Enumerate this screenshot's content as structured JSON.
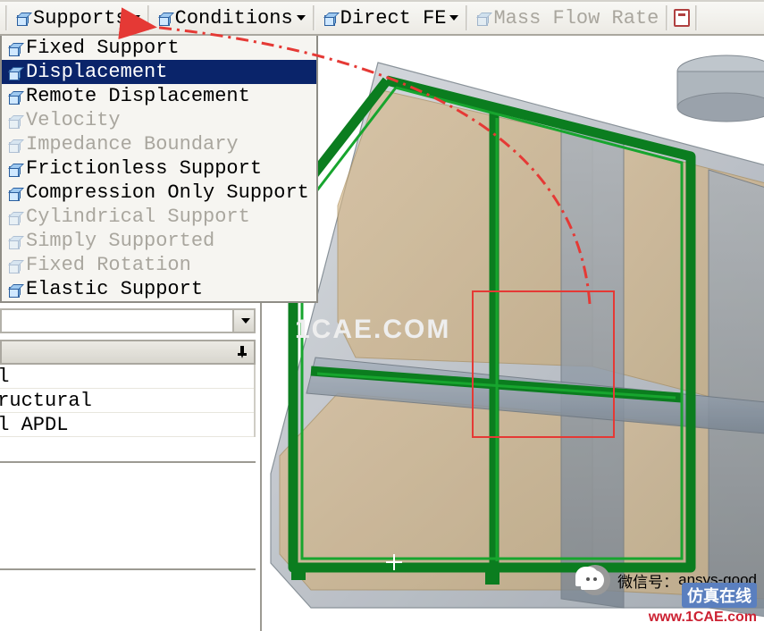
{
  "toolbar": {
    "supports": "Supports",
    "conditions": "Conditions",
    "directfe": "Direct FE",
    "massflow": "Mass Flow Rate"
  },
  "dropdown": {
    "items": [
      {
        "label": "Fixed Support",
        "enabled": true
      },
      {
        "label": "Displacement",
        "enabled": true,
        "selected": true
      },
      {
        "label": "Remote Displacement",
        "enabled": true
      },
      {
        "label": "Velocity",
        "enabled": false
      },
      {
        "label": "Impedance Boundary",
        "enabled": false
      },
      {
        "label": "Frictionless Support",
        "enabled": true
      },
      {
        "label": "Compression Only Support",
        "enabled": true
      },
      {
        "label": "Cylindrical Support",
        "enabled": false
      },
      {
        "label": "Simply Supported",
        "enabled": false
      },
      {
        "label": "Fixed Rotation",
        "enabled": false
      },
      {
        "label": "Elastic Support",
        "enabled": true
      }
    ]
  },
  "leftlist": {
    "rows": [
      "al",
      "tructural",
      "al APDL"
    ]
  },
  "watermark": "1CAE.COM",
  "footer": {
    "wechat_label": "微信号：",
    "wechat_id": "ansys-good",
    "site_cn": "仿真在线",
    "site_url": "www.1CAE.com"
  }
}
